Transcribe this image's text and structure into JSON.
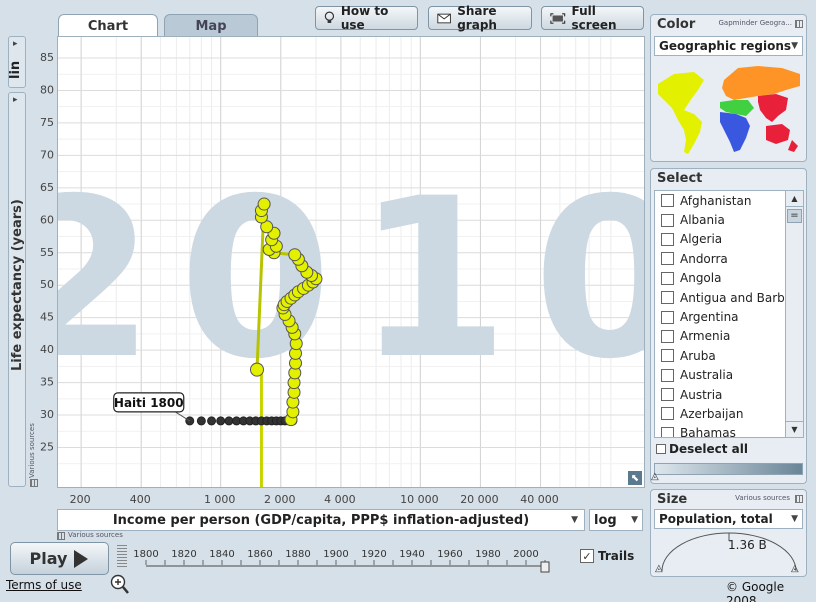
{
  "tabs": [
    {
      "label": "Chart"
    },
    {
      "label": "Map"
    }
  ],
  "toolbar": {
    "how_to_use": "How to use",
    "share_graph": "Share graph",
    "full_screen": "Full screen"
  },
  "y_scale": {
    "label": "lin"
  },
  "y_axis": {
    "label": "Life expectancy (years)",
    "sources": "Various sources"
  },
  "x_axis": {
    "label": "Income per person (GDP/capita, PPP$ inflation-adjusted)",
    "scale": "log",
    "sources": "Various sources"
  },
  "year_watermark": "2010",
  "bubble_label": "Haiti 1800",
  "color_panel": {
    "title": "Color",
    "credit": "Gapminder Geogra...",
    "selected": "Geographic regions",
    "regions": {
      "americas": "#e3f000",
      "europe_central_asia": "#ff9426",
      "africa": "#3a57e0",
      "middle_east": "#40d040",
      "east_asia_pacific": "#e8203a"
    }
  },
  "select_panel": {
    "title": "Select",
    "deselect_all": "Deselect all",
    "countries": [
      "Afghanistan",
      "Albania",
      "Algeria",
      "Andorra",
      "Angola",
      "Antigua and Barb...",
      "Argentina",
      "Armenia",
      "Aruba",
      "Australia",
      "Austria",
      "Azerbaijan",
      "Bahamas"
    ]
  },
  "size_panel": {
    "title": "Size",
    "sources": "Various sources",
    "selected": "Population, total",
    "value": "1.36 B"
  },
  "timeline": {
    "play_label": "Play",
    "ticks": [
      "1800",
      "1820",
      "1840",
      "1860",
      "1880",
      "1900",
      "1920",
      "1940",
      "1960",
      "1980",
      "2000"
    ],
    "trails_label": "Trails",
    "trails_checked": true,
    "current_year": 2010
  },
  "footer": {
    "terms": "Terms of use",
    "copyright": "© Google 2008"
  },
  "chart_data": {
    "type": "scatter",
    "title": "",
    "xlabel": "Income per person (GDP/capita, PPP$ inflation-adjusted)",
    "ylabel": "Life expectancy (years)",
    "x_scale": "log",
    "xlim": [
      180,
      100000
    ],
    "ylim": [
      22,
      87
    ],
    "x_ticks": [
      {
        "value": 200,
        "label": "200"
      },
      {
        "value": 400,
        "label": "400"
      },
      {
        "value": 1000,
        "label": "1 000"
      },
      {
        "value": 2000,
        "label": "2 000"
      },
      {
        "value": 4000,
        "label": "4 000"
      },
      {
        "value": 10000,
        "label": "10 000"
      },
      {
        "value": 20000,
        "label": "20 000"
      },
      {
        "value": 40000,
        "label": "40 000"
      }
    ],
    "y_ticks": [
      25,
      30,
      35,
      40,
      45,
      50,
      55,
      60,
      65,
      70,
      75,
      80,
      85
    ],
    "series": [
      {
        "name": "Haiti",
        "color": "#e3f000",
        "trail_dark": [
          [
            700,
            29.1
          ],
          [
            800,
            29.1
          ],
          [
            900,
            29.1
          ],
          [
            1000,
            29.1
          ],
          [
            1100,
            29.1
          ],
          [
            1200,
            29.1
          ],
          [
            1300,
            29.1
          ],
          [
            1400,
            29.1
          ],
          [
            1500,
            29.1
          ],
          [
            1600,
            29.1
          ],
          [
            1700,
            29.1
          ],
          [
            1800,
            29.1
          ],
          [
            1900,
            29.1
          ],
          [
            2000,
            29.1
          ],
          [
            2100,
            29.1
          ],
          [
            2200,
            29.1
          ],
          [
            2300,
            29.1
          ]
        ],
        "points": [
          [
            2250,
            29.3
          ],
          [
            2300,
            30.5
          ],
          [
            2300,
            32
          ],
          [
            2330,
            33.5
          ],
          [
            2330,
            35
          ],
          [
            2350,
            36.5
          ],
          [
            2370,
            38
          ],
          [
            2370,
            39.5
          ],
          [
            2390,
            41
          ],
          [
            2350,
            42.5
          ],
          [
            2280,
            43.5
          ],
          [
            2200,
            44.5
          ],
          [
            2100,
            45.5
          ],
          [
            2050,
            46.5
          ],
          [
            2080,
            47
          ],
          [
            2150,
            47.5
          ],
          [
            2250,
            48
          ],
          [
            2350,
            48.5
          ],
          [
            2450,
            49
          ],
          [
            2600,
            49.5
          ],
          [
            2750,
            50
          ],
          [
            2900,
            50.5
          ],
          [
            3000,
            51
          ],
          [
            2850,
            51.5
          ],
          [
            2700,
            52
          ],
          [
            2550,
            53
          ],
          [
            2450,
            54
          ],
          [
            2350,
            54.7
          ],
          [
            1850,
            55
          ],
          [
            1750,
            55.5
          ],
          [
            1900,
            56
          ],
          [
            1800,
            57
          ],
          [
            1850,
            58
          ],
          [
            1700,
            59
          ],
          [
            1600,
            60.5
          ],
          [
            1600,
            61.5
          ],
          [
            1650,
            62.5
          ],
          [
            1520,
            37
          ]
        ]
      }
    ]
  }
}
